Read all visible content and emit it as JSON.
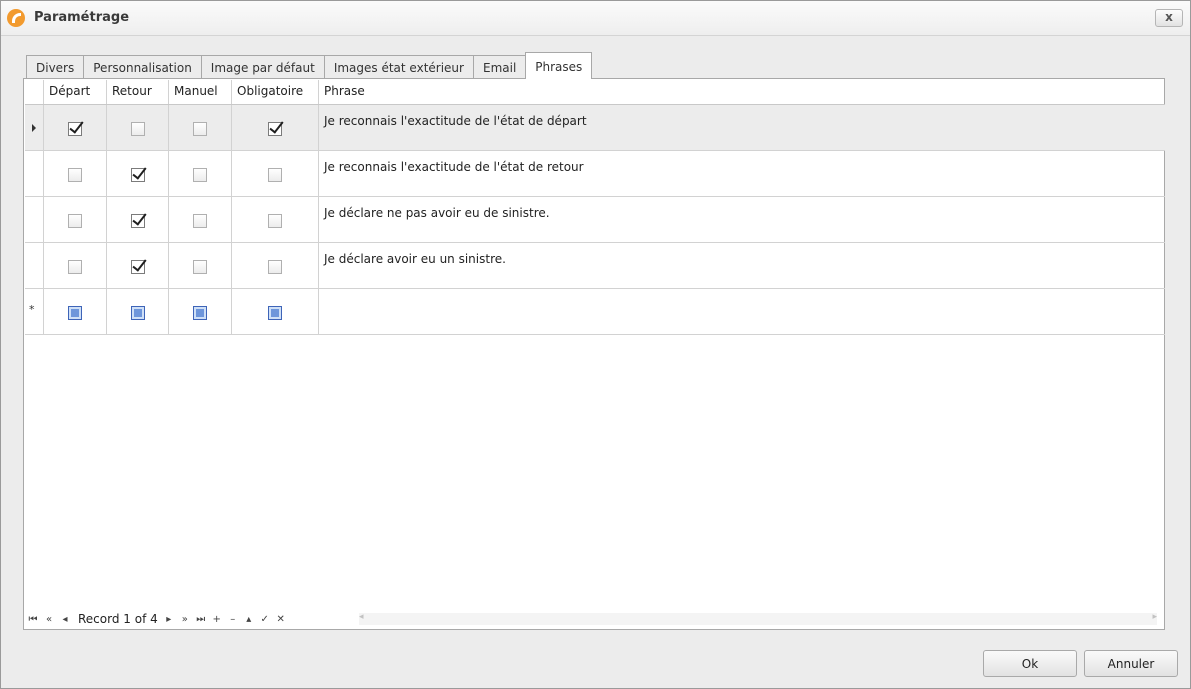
{
  "window": {
    "title": "Paramétrage",
    "close_glyph": "x"
  },
  "tabs": [
    {
      "label": "Divers"
    },
    {
      "label": "Personnalisation"
    },
    {
      "label": "Image par défaut"
    },
    {
      "label": "Images état extérieur"
    },
    {
      "label": "Email"
    },
    {
      "label": "Phrases"
    }
  ],
  "active_tab": "Phrases",
  "grid": {
    "columns": [
      "Départ",
      "Retour",
      "Manuel",
      "Obligatoire",
      "Phrase"
    ],
    "rows": [
      {
        "depart": true,
        "retour": false,
        "manuel": false,
        "obligatoire": true,
        "phrase": "Je reconnais l'exactitude de l'état de départ",
        "selected": true
      },
      {
        "depart": false,
        "retour": true,
        "manuel": false,
        "obligatoire": false,
        "phrase": "Je reconnais l'exactitude de l'état de retour"
      },
      {
        "depart": false,
        "retour": true,
        "manuel": false,
        "obligatoire": false,
        "phrase": "Je déclare ne pas avoir eu de sinistre."
      },
      {
        "depart": false,
        "retour": true,
        "manuel": false,
        "obligatoire": false,
        "phrase": "Je déclare avoir eu un sinistre."
      }
    ],
    "new_row_indicator": "*",
    "current_row_indicator": "arrow-right-icon"
  },
  "navigator": {
    "record_text": "Record 1 of 4",
    "buttons": {
      "first": "⏮",
      "prev_page": "«",
      "prev": "◂",
      "next": "▸",
      "next_page": "»",
      "last": "⏭",
      "append": "+",
      "remove": "–",
      "edit": "▴",
      "end_edit": "✓",
      "cancel_edit": "✕"
    }
  },
  "buttons": {
    "ok": "Ok",
    "cancel": "Annuler"
  },
  "colors": {
    "accent_icon": "#f29a2e",
    "null_checkbox": "#6e96db",
    "selected_row": "#ececec"
  }
}
